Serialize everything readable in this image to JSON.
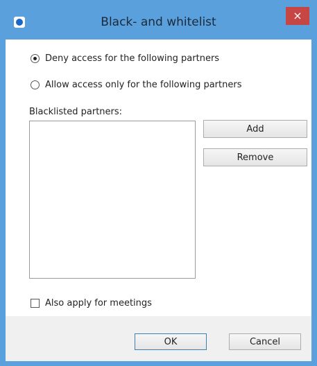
{
  "window": {
    "title": "Black- and whitelist",
    "close_label": "×",
    "app_icon": "teamviewer-icon"
  },
  "access": {
    "deny_label": "Deny access for the following partners",
    "allow_label": "Allow access only for the following partners",
    "selected": "deny"
  },
  "list": {
    "label": "Blacklisted partners:",
    "items": []
  },
  "buttons": {
    "add": "Add",
    "remove": "Remove",
    "ok": "OK",
    "cancel": "Cancel"
  },
  "meetings": {
    "label": "Also apply for meetings",
    "checked": false
  },
  "colors": {
    "title_bar": "#5aa0dc",
    "close_button": "#c64545"
  }
}
